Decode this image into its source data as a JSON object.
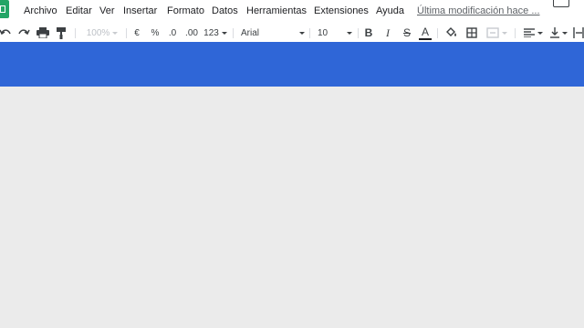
{
  "menu": {
    "items": [
      "Archivo",
      "Editar",
      "Ver",
      "Insertar",
      "Formato",
      "Datos",
      "Herramientas",
      "Extensiones",
      "Ayuda"
    ],
    "last_edit": "Última modificación hace ..."
  },
  "toolbar": {
    "zoom": "100%",
    "currency": "€",
    "percent": "%",
    "decrease_decimals": ".0",
    "increase_decimals": ".00",
    "number_format": "123",
    "font": "Arial",
    "font_size": "10",
    "bold": "B",
    "italic": "I",
    "strikethrough": "S",
    "text_color": "A"
  },
  "colors": {
    "brand": "#2f66d7",
    "sheets_green": "#23a566",
    "background": "#ebebeb"
  }
}
